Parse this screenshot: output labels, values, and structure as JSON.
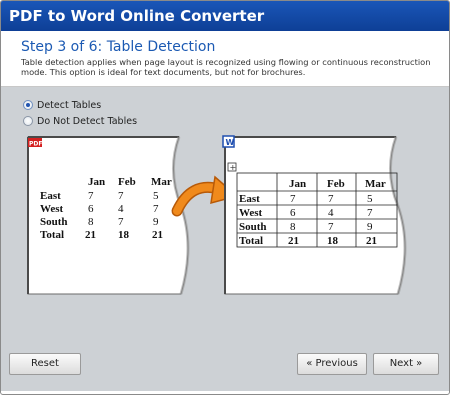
{
  "window": {
    "title": "PDF to Word Online Converter"
  },
  "header": {
    "step_title": "Step 3 of 6: Table Detection",
    "description": "Table detection applies when page layout is recognized using flowing or continuous reconstruction mode. This option is ideal for text documents, but not for brochures."
  },
  "options": {
    "detect_label": "Detect Tables",
    "no_detect_label": "Do Not Detect Tables",
    "selected": "Detect Tables"
  },
  "pdf_page": {
    "badge": "PDF",
    "headers": [
      "Jan",
      "Feb",
      "Mar"
    ],
    "rows": [
      {
        "label": "East",
        "values": [
          "7",
          "7",
          "5"
        ]
      },
      {
        "label": "West",
        "values": [
          "6",
          "4",
          "7"
        ]
      },
      {
        "label": "South",
        "values": [
          "8",
          "7",
          "9"
        ]
      },
      {
        "label": "Total",
        "values": [
          "21",
          "18",
          "21"
        ]
      }
    ]
  },
  "word_page": {
    "badge": "W",
    "move_handle": "+",
    "headers": [
      "Jan",
      "Feb",
      "Mar"
    ],
    "rows": [
      {
        "label": "East",
        "values": [
          "7",
          "7",
          "5"
        ]
      },
      {
        "label": "West",
        "values": [
          "6",
          "4",
          "7"
        ]
      },
      {
        "label": "South",
        "values": [
          "8",
          "7",
          "9"
        ]
      },
      {
        "label": "Total",
        "values": [
          "21",
          "18",
          "21"
        ]
      }
    ]
  },
  "buttons": {
    "reset": "Reset",
    "previous": "« Previous",
    "next": "Next »"
  },
  "colors": {
    "titlebar": "#1a56b8",
    "step_title": "#1c5ab3",
    "content_bg": "#cdd1d5",
    "arrow": "#f08a1c",
    "pdf_badge": "#d42020",
    "word_badge": "#1f4fb0"
  },
  "icons": {
    "arrow": "curved-arrow-icon",
    "pdf": "pdf-badge-icon",
    "word": "word-badge-icon",
    "move": "table-move-handle-icon"
  }
}
